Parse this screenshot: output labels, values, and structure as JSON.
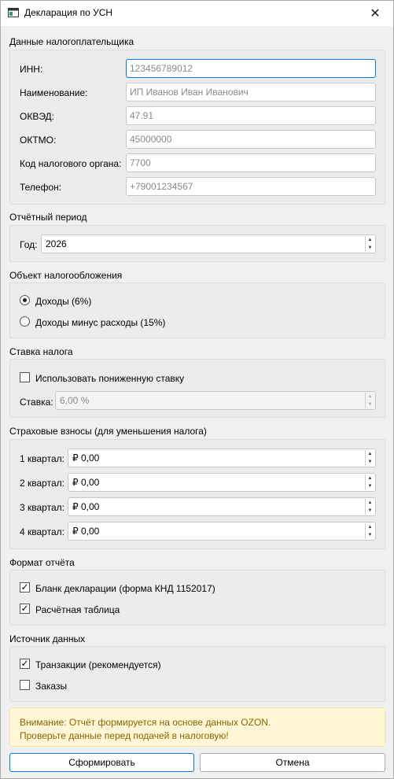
{
  "window": {
    "title": "Декларация по УСН",
    "close_glyph": "✕"
  },
  "taxpayer": {
    "section_title": "Данные налогоплательщика",
    "fields": [
      {
        "label": "ИНН:",
        "value": "123456789012"
      },
      {
        "label": "Наименование:",
        "value": "ИП Иванов Иван Иванович"
      },
      {
        "label": "ОКВЭД:",
        "value": "47.91"
      },
      {
        "label": "ОКТМО:",
        "value": "45000000"
      },
      {
        "label": "Код налогового органа:",
        "value": "7700"
      },
      {
        "label": "Телефон:",
        "value": "+79001234567"
      }
    ]
  },
  "period": {
    "section_title": "Отчётный период",
    "year_label": "Год:",
    "year_value": "2026"
  },
  "tax_object": {
    "section_title": "Объект налогообложения",
    "options": [
      "Доходы (6%)",
      "Доходы минус расходы (15%)"
    ],
    "selected_index": 0
  },
  "tax_rate": {
    "section_title": "Ставка налога",
    "reduced_label": "Использовать пониженную ставку",
    "reduced_checked": false,
    "rate_label": "Ставка:",
    "rate_value": "6,00 %"
  },
  "insurance": {
    "section_title": "Страховые взносы (для уменьшения налога)",
    "quarters": [
      {
        "label": "1 квартал:",
        "value": "₽ 0,00"
      },
      {
        "label": "2 квартал:",
        "value": "₽ 0,00"
      },
      {
        "label": "3 квартал:",
        "value": "₽ 0,00"
      },
      {
        "label": "4 квартал:",
        "value": "₽ 0,00"
      }
    ]
  },
  "report_format": {
    "section_title": "Формат отчёта",
    "options": [
      {
        "label": "Бланк декларации (форма КНД 1152017)",
        "checked": true
      },
      {
        "label": "Расчётная таблица",
        "checked": true
      }
    ]
  },
  "data_source": {
    "section_title": "Источник данных",
    "options": [
      {
        "label": "Транзакции (рекомендуется)",
        "checked": true
      },
      {
        "label": "Заказы",
        "checked": false
      }
    ]
  },
  "warning": {
    "line1": "Внимание: Отчёт формируется на основе данных OZON.",
    "line2": "Проверьте данные перед подачей в налоговую!"
  },
  "buttons": {
    "submit": "Сформировать",
    "cancel": "Отмена"
  },
  "colors": {
    "accent": "#0078d7",
    "warning_bg": "#fff7d6",
    "warning_text": "#8a6400"
  }
}
